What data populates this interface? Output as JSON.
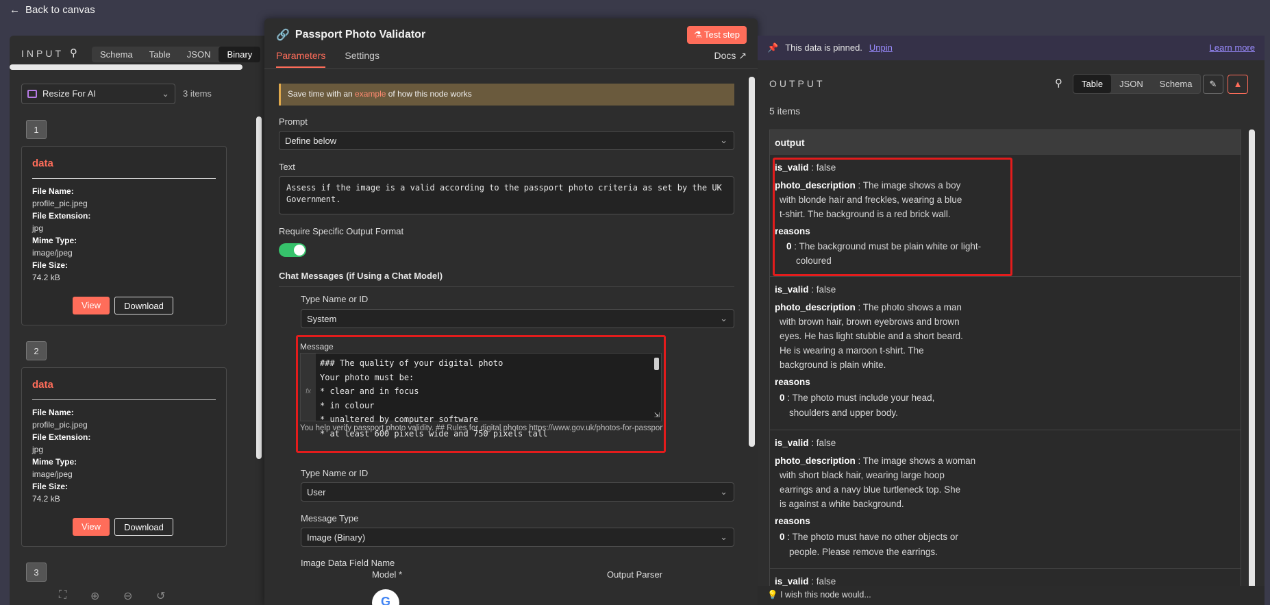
{
  "canvas": {
    "back_label": "Back to canvas"
  },
  "input": {
    "title": "INPUT",
    "tabs": [
      "Schema",
      "Table",
      "JSON",
      "Binary"
    ],
    "active_tab": "Binary",
    "node_select": "Resize For AI",
    "items_count": "3 items",
    "items": [
      {
        "index": "1",
        "title": "data",
        "file_name_label": "File Name:",
        "file_name": "profile_pic.jpeg",
        "ext_label": "File Extension:",
        "ext": "jpg",
        "mime_label": "Mime Type:",
        "mime": "image/jpeg",
        "size_label": "File Size:",
        "size": "74.2 kB",
        "view": "View",
        "download": "Download"
      },
      {
        "index": "2",
        "title": "data",
        "file_name_label": "File Name:",
        "file_name": "profile_pic.jpeg",
        "ext_label": "File Extension:",
        "ext": "jpg",
        "mime_label": "Mime Type:",
        "mime": "image/jpeg",
        "size_label": "File Size:",
        "size": "74.2 kB",
        "view": "View",
        "download": "Download"
      },
      {
        "index": "3"
      }
    ]
  },
  "modal": {
    "title": "Passport Photo Validator",
    "test_step": "Test step",
    "tabs": [
      "Parameters",
      "Settings"
    ],
    "docs": "Docs",
    "callout": {
      "pre": "Save time with an ",
      "link": "example",
      "post": " of how this node works"
    },
    "prompt_label": "Prompt",
    "prompt_value": "Define below",
    "text_label": "Text",
    "text_value": "Assess if the image is a valid according to the passport photo criteria as set by the UK Government.",
    "require_format_label": "Require Specific Output Format",
    "chat_section": "Chat Messages (if Using a Chat Model)",
    "type_label_1": "Type Name or ID",
    "type_value_1": "System",
    "message_label": "Message",
    "gutter": "fx",
    "message_lines": [
      "### The quality of your digital photo",
      "Your photo must be:",
      "* clear and in focus",
      "* in colour",
      "* unaltered by computer software",
      "* at least 600 pixels wide and 750 pixels tall"
    ],
    "message_preview": "You help verify passport photo validity. ## Rules for digital photos https://www.gov.uk/photos-for-passports ##...",
    "type_label_2": "Type Name or ID",
    "type_value_2": "User",
    "message_type_label": "Message Type",
    "message_type_value": "Image (Binary)",
    "image_field_label": "Image Data Field Name",
    "model_label": "Model *",
    "parser_label": "Output Parser"
  },
  "output": {
    "pin_notice": "This data is pinned.",
    "unpin": "Unpin",
    "learn_more": "Learn more",
    "title": "OUTPUT",
    "tabs": [
      "Table",
      "JSON",
      "Schema"
    ],
    "active_tab": "Table",
    "items_count": "5 items",
    "column": "output",
    "rows": [
      {
        "is_valid_key": "is_valid",
        "is_valid": " : false",
        "desc_key": "photo_description",
        "desc_lines": [
          " : The image shows a boy",
          "with blonde hair and freckles, wearing a blue",
          "t-shirt. The background is a red brick wall."
        ],
        "reasons_key": "reasons",
        "reason_index": "0",
        "reason_lines": [
          " : The background must be plain white or light-",
          "coloured"
        ]
      },
      {
        "is_valid_key": "is_valid",
        "is_valid": " : false",
        "desc_key": "photo_description",
        "desc_lines": [
          " : The photo shows a man",
          "with brown hair, brown eyebrows and brown",
          "eyes. He has light stubble and a short beard.",
          "He is wearing a maroon t-shirt.  The",
          "background is plain white."
        ],
        "reasons_key": "reasons",
        "reason_index": "0",
        "reason_lines": [
          " : The photo must include your head,",
          "shoulders and upper body."
        ]
      },
      {
        "is_valid_key": "is_valid",
        "is_valid": " : false",
        "desc_key": "photo_description",
        "desc_lines": [
          " : The image shows a woman",
          "with short black hair, wearing large hoop",
          "earrings and a navy blue turtleneck top. She",
          "is against a white background."
        ],
        "reasons_key": "reasons",
        "reason_index": "0",
        "reason_lines": [
          " : The photo must have no other objects or",
          "people. Please remove the earrings."
        ]
      },
      {
        "is_valid_key": "is_valid",
        "is_valid": " : false"
      }
    ],
    "wish": "I wish this node would..."
  },
  "colors": {
    "accent": "#ff6d5a",
    "highlight": "#e31c1c",
    "toggle_on": "#36c26b",
    "pin_link": "#9a8cff"
  }
}
